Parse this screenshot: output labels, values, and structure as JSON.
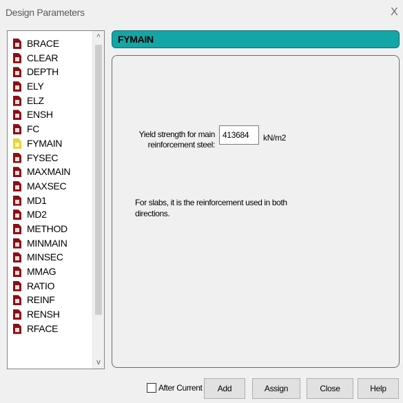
{
  "window": {
    "title": "Design Parameters",
    "close_glyph": "X"
  },
  "list": {
    "selected": "FYMAIN",
    "items": [
      "BRACE",
      "CLEAR",
      "DEPTH",
      "ELY",
      "ELZ",
      "ENSH",
      "FC",
      "FYMAIN",
      "FYSEC",
      "MAXMAIN",
      "MAXSEC",
      "MD1",
      "MD2",
      "METHOD",
      "MINMAIN",
      "MINSEC",
      "MMAG",
      "RATIO",
      "REINF",
      "RENSH",
      "RFACE"
    ],
    "icon": "document-icon",
    "selected_icon": "document-selected-icon",
    "scroll_up_glyph": "^",
    "scroll_down_glyph": "v"
  },
  "parameter": {
    "name": "FYMAIN",
    "field_label": "Yield strength for main reinforcement steel:",
    "value": "413684",
    "unit": "kN/m2",
    "description": "For slabs, it is the reinforcement used in both directions.",
    "header_color": "#14a6a6"
  },
  "buttons": {
    "after_current_label": "After Current",
    "after_current_checked": false,
    "add": "Add",
    "assign": "Assign",
    "close": "Close",
    "help": "Help"
  }
}
